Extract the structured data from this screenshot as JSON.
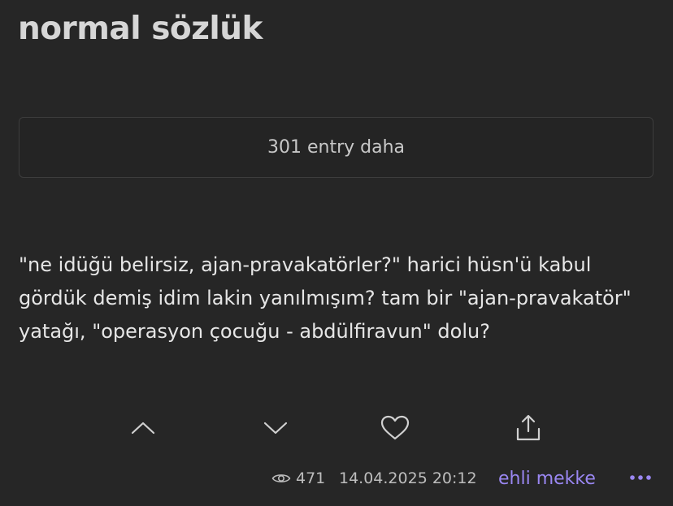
{
  "header": {
    "title": "normal sözlük"
  },
  "more_entries": {
    "label": "301 entry daha"
  },
  "entry": {
    "text": "\"ne idüğü belirsiz, ajan-pravakatörler?\" harici hüsn'ü kabul gördük demiş idim lakin yanılmışım? tam bir \"ajan-pravakatör\" yatağı, \"operasyon çocuğu - abdülfiravun\" dolu?"
  },
  "actions": {
    "upvote_icon": "chevron-up-icon",
    "downvote_icon": "chevron-down-icon",
    "favorite_icon": "heart-icon",
    "share_icon": "share-icon"
  },
  "meta": {
    "views": "471",
    "date": "14.04.2025 20:12",
    "author": "ehli mekke",
    "author_color": "#9a87f2",
    "more_icon": "more-dots-icon"
  }
}
